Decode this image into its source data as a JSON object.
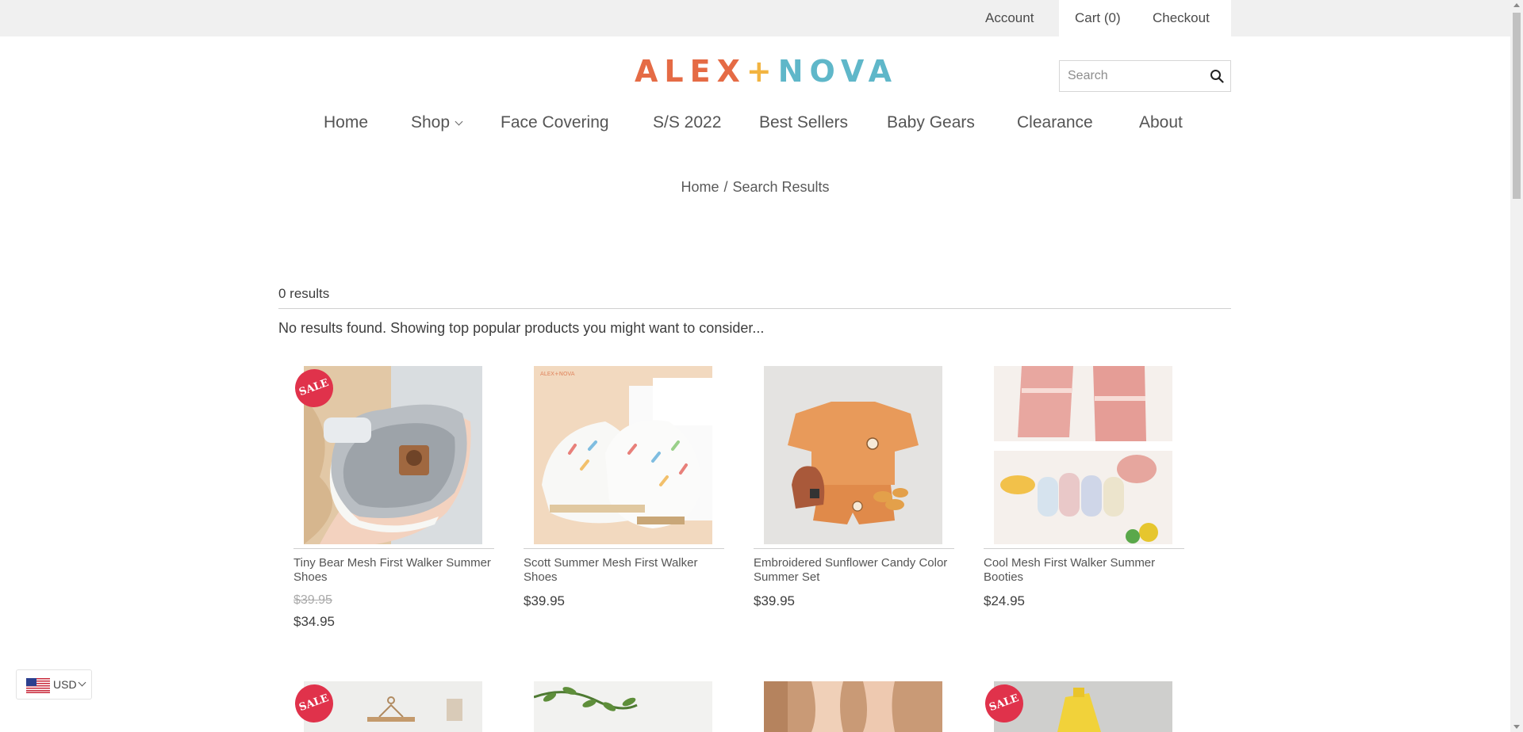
{
  "topbar": {
    "account_label": "Account",
    "cart_label": "Cart (0)",
    "checkout_label": "Checkout"
  },
  "brand": {
    "part1": "ALEX",
    "plus": "+",
    "part2": "NOVA",
    "colors": {
      "alex": "#e56b45",
      "plus": "#f2b441",
      "nova": "#5fb7c9"
    }
  },
  "search": {
    "placeholder": "Search",
    "value": ""
  },
  "nav": {
    "items": [
      {
        "label": "Home"
      },
      {
        "label": "Shop",
        "has_dropdown": true
      },
      {
        "label": "Face Covering"
      },
      {
        "label": "S/S 2022"
      },
      {
        "label": "Best Sellers"
      },
      {
        "label": "Baby Gears"
      },
      {
        "label": "Clearance"
      },
      {
        "label": "About"
      }
    ]
  },
  "breadcrumb": {
    "home": "Home",
    "separator": "/",
    "current": "Search Results"
  },
  "results": {
    "count_text": "0 results",
    "message": "No results found. Showing top popular products you might want to consider..."
  },
  "products": [
    {
      "title": "Tiny Bear Mesh First Walker Summer Shoes",
      "old_price": "$39.95",
      "price": "$34.95",
      "sale": true,
      "sale_label": "SALE"
    },
    {
      "title": "Scott Summer Mesh First Walker Shoes",
      "price": "$39.95",
      "sale": false
    },
    {
      "title": "Embroidered Sunflower Candy Color Summer Set",
      "price": "$39.95",
      "sale": false
    },
    {
      "title": "Cool Mesh First Walker Summer Booties",
      "price": "$24.95",
      "sale": false
    }
  ],
  "second_row": [
    {
      "sale": true,
      "sale_label": "SALE"
    },
    {
      "sale": false
    },
    {
      "sale": false
    },
    {
      "sale": true,
      "sale_label": "SALE"
    }
  ],
  "currency": {
    "code": "USD",
    "icon": "us-flag-icon"
  },
  "icons": {
    "search": "search-icon",
    "dropdown": "chevron-down-icon"
  },
  "theme": {
    "sale_badge": "#e0324b",
    "topbar_bg": "#f0f0f0"
  }
}
